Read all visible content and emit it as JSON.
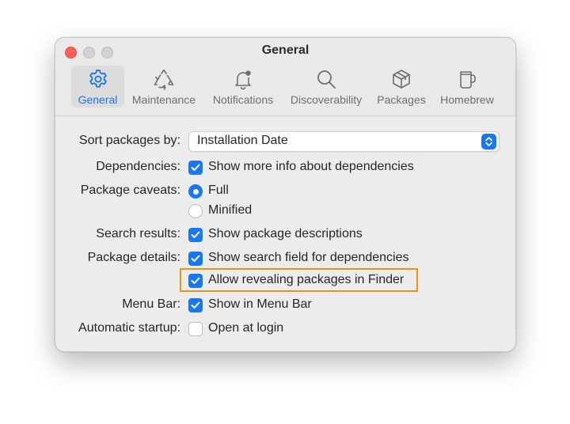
{
  "window": {
    "title": "General"
  },
  "tabs": [
    {
      "label": "General",
      "icon": "gear-icon",
      "active": true
    },
    {
      "label": "Maintenance",
      "icon": "recycle-icon",
      "active": false
    },
    {
      "label": "Notifications",
      "icon": "bell-icon",
      "active": false
    },
    {
      "label": "Discoverability",
      "icon": "magnifier-icon",
      "active": false
    },
    {
      "label": "Packages",
      "icon": "package-icon",
      "active": false
    },
    {
      "label": "Homebrew",
      "icon": "mug-icon",
      "active": false
    }
  ],
  "settings": {
    "sort": {
      "label": "Sort packages by:",
      "value": "Installation Date"
    },
    "dependencies": {
      "label": "Dependencies:",
      "option": "Show more info about dependencies",
      "checked": true
    },
    "caveats": {
      "label": "Package caveats:",
      "options": [
        "Full",
        "Minified"
      ],
      "selected": "Full"
    },
    "search_results": {
      "label": "Search results:",
      "option": "Show package descriptions",
      "checked": true
    },
    "package_details": {
      "label": "Package details:",
      "options": [
        {
          "text": "Show search field for dependencies",
          "checked": true
        },
        {
          "text": "Allow revealing packages in Finder",
          "checked": true
        }
      ]
    },
    "menu_bar": {
      "label": "Menu Bar:",
      "option": "Show in Menu Bar",
      "checked": true
    },
    "startup": {
      "label": "Automatic startup:",
      "option": "Open at login",
      "checked": false
    }
  },
  "colors": {
    "accent": "#1877f2",
    "highlight": "#e6951c",
    "close": "#fe5f57"
  }
}
